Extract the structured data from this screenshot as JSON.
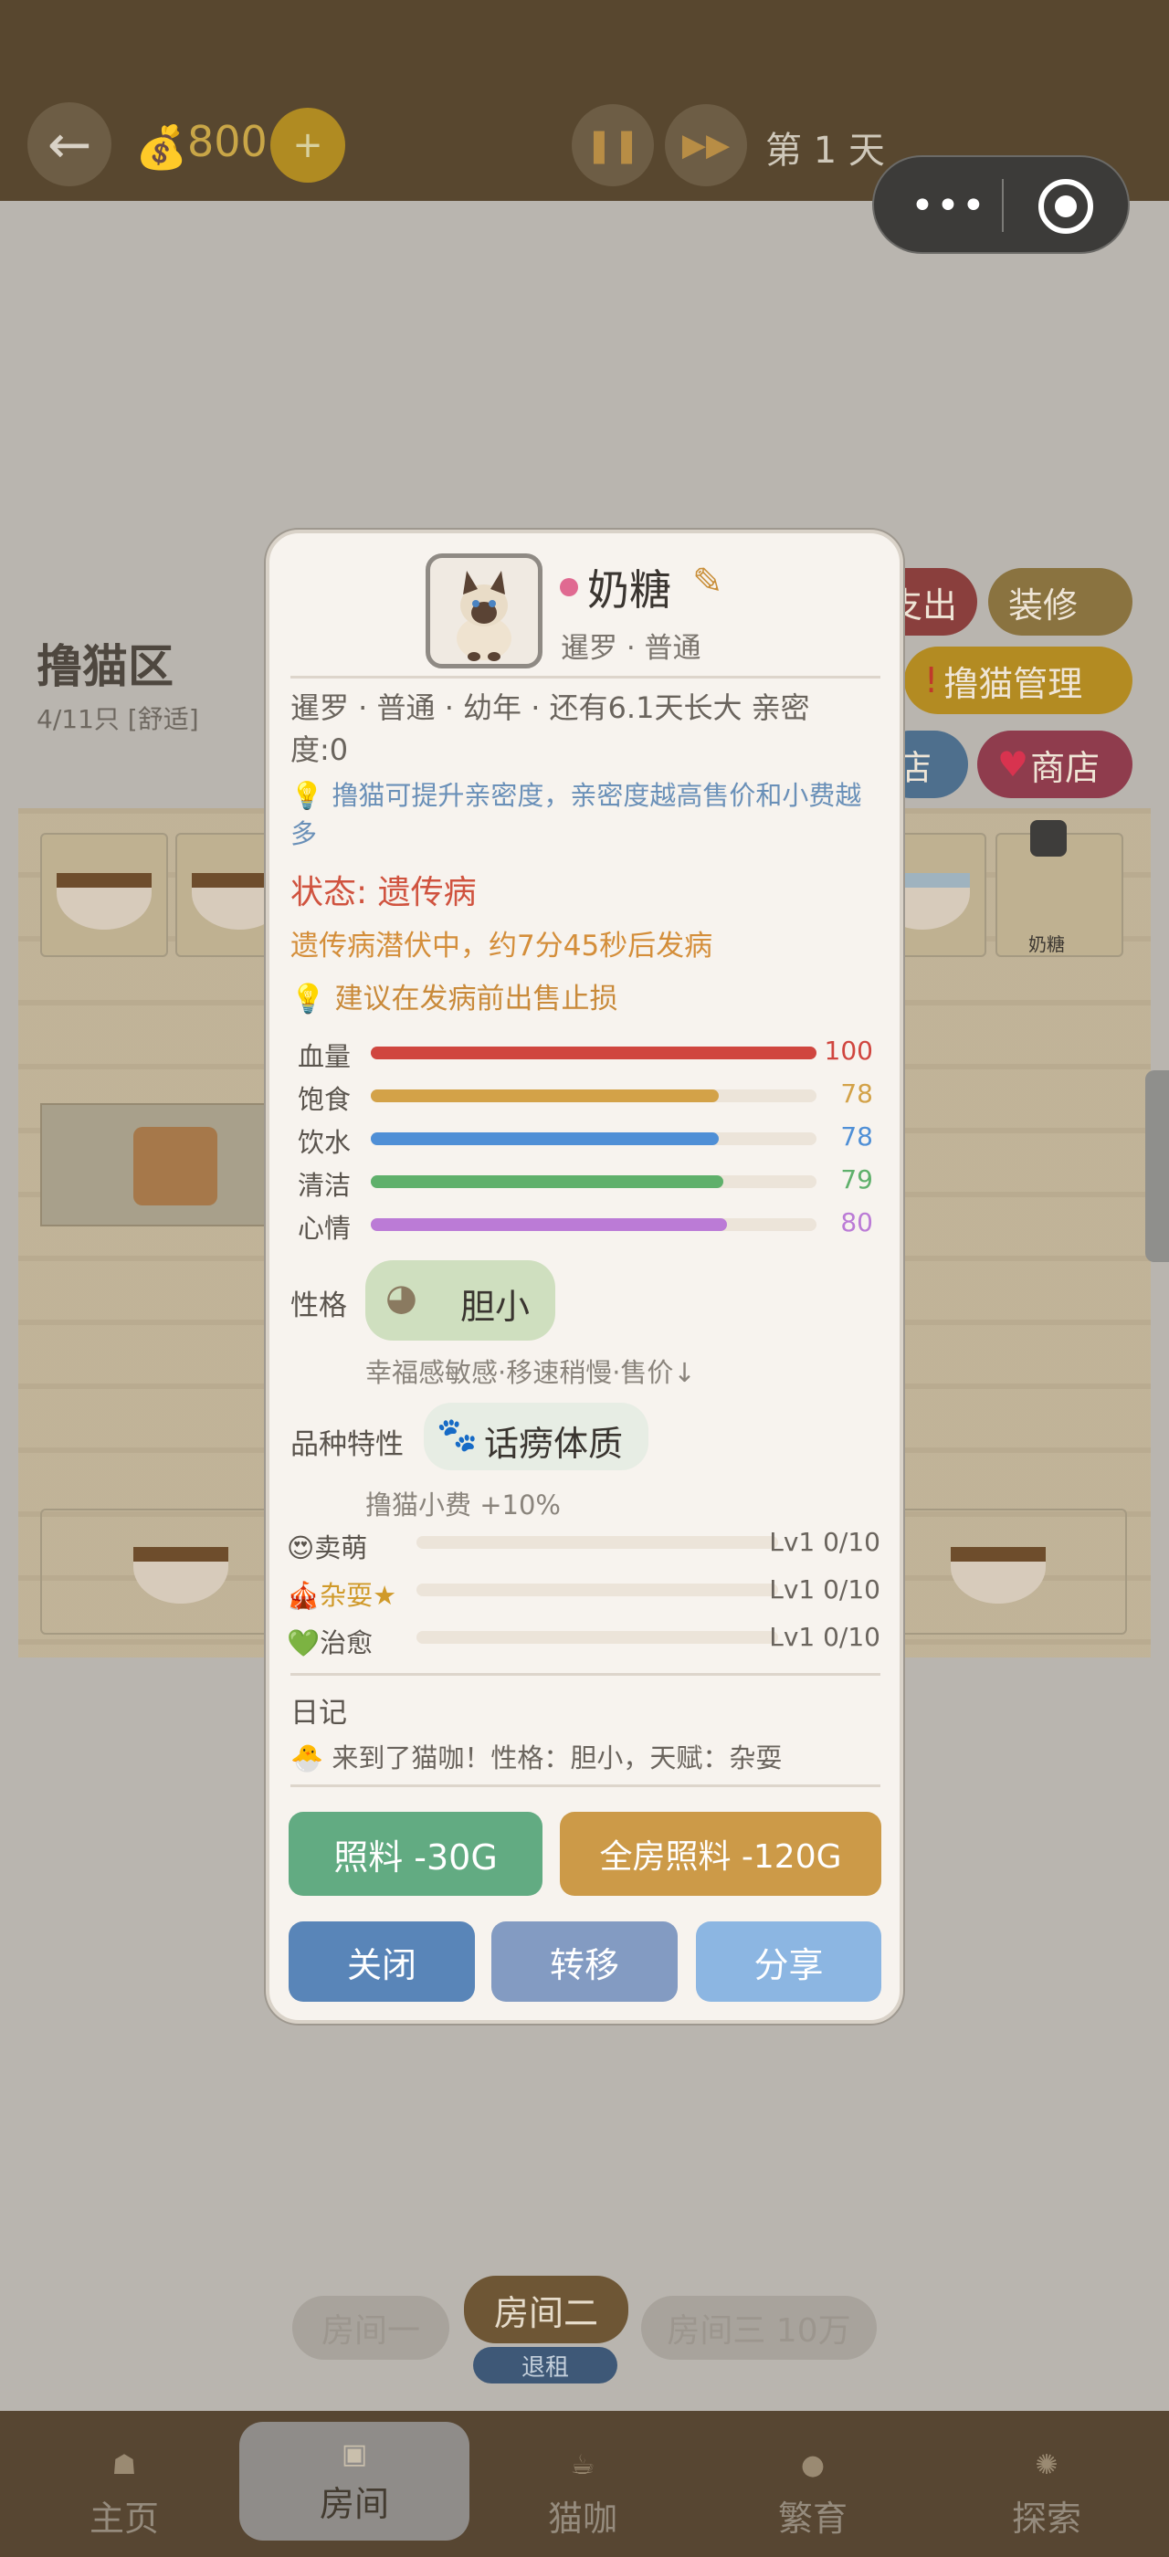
{
  "topbar": {
    "back_icon": "←",
    "coin_icon": "money-bag-icon",
    "coins": "800",
    "add_icon": "+",
    "day_label": "第 1 天",
    "capsule_more": "•••"
  },
  "room": {
    "title": "撸猫区",
    "count": "4/11只 [舒适]",
    "mini_cat_label": "奶糖",
    "side_buttons": [
      "支出",
      "装修",
      "撸猫管理",
      "店",
      "商店"
    ]
  },
  "room_tabs": {
    "room1": "房间一",
    "room2": "房间二",
    "room3": "房间三 10万",
    "unrent": "退租"
  },
  "bottom_nav": {
    "items": [
      {
        "label": "主页"
      },
      {
        "label": "房间"
      },
      {
        "label": "猫咖"
      },
      {
        "label": "繁育"
      },
      {
        "label": "探索"
      }
    ],
    "active": "房间"
  },
  "cat": {
    "name": "奶糖",
    "breed_sub": "暹罗 · 普通",
    "info_line": "暹罗 · 普通 · 幼年 · 还有6.1天长大 亲密度:0",
    "tip1": "撸猫可提升亲密度，亲密度越高售价和小费越多",
    "status": "状态: 遗传病",
    "latent": "遗传病潜伏中，约7分45秒后发病",
    "tip2": "建议在发病前出售止损",
    "stats": [
      {
        "name": "血量",
        "value": 100,
        "color": "#d0463f"
      },
      {
        "name": "饱食",
        "value": 78,
        "color": "#d3a248"
      },
      {
        "name": "饮水",
        "value": 78,
        "color": "#4f8fd6"
      },
      {
        "name": "清洁",
        "value": 79,
        "color": "#5fb06b"
      },
      {
        "name": "心情",
        "value": 80,
        "color": "#bb7bd6"
      }
    ],
    "personality_label": "性格",
    "personality": "胆小",
    "personality_desc": "幸福感敏感·移速稍慢·售价↓",
    "trait_label": "品种特性",
    "trait": "话痨体质",
    "trait_desc": "撸猫小费 +10%",
    "skills": [
      {
        "icon": "😍",
        "name": "卖萌",
        "level": "Lv1 0/10",
        "color": "#5a544d"
      },
      {
        "icon": "🎪",
        "name": "杂耍★",
        "level": "Lv1 0/10",
        "color": "#d09a2a"
      },
      {
        "icon": "💚",
        "name": "治愈",
        "level": "Lv1 0/10",
        "color": "#5a544d"
      }
    ],
    "diary_label": "日记",
    "diary_entry": "来到了猫咖！性格：胆小，天赋：杂耍"
  },
  "actions": {
    "feed": "照料 -30G",
    "feed_all": "全房照料 -120G",
    "close": "关闭",
    "move": "转移",
    "share": "分享"
  }
}
